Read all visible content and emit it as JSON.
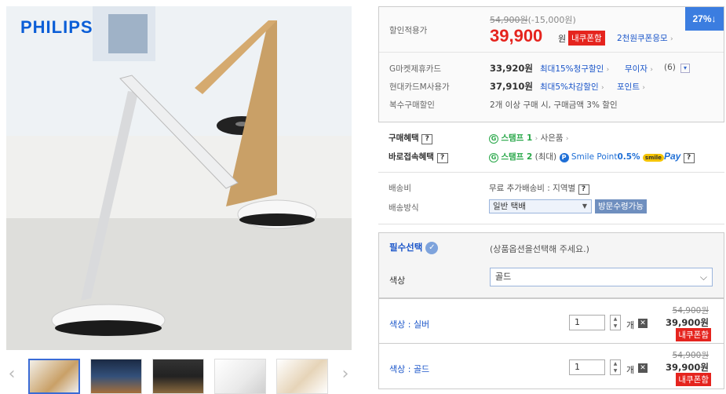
{
  "product_image": {
    "brand": "PHILIPS",
    "thumbnails": [
      {
        "name": "thumb-gold-lamp"
      },
      {
        "name": "thumb-room"
      },
      {
        "name": "thumb-desk"
      },
      {
        "name": "thumb-white-lamp"
      },
      {
        "name": "thumb-gold-lamp-2"
      }
    ]
  },
  "price": {
    "label": "할인적용가",
    "original": "54,900원",
    "discount_amount": "(-15,000원)",
    "sale": "39,900",
    "sale_unit": "원",
    "coupon_badge": "내쿠폰함",
    "coupon_link": "2천원쿠폰응모",
    "discount_badge": "27%↓"
  },
  "cards": [
    {
      "label": "G마켓제휴카드",
      "price": "33,920원",
      "benefit": "최대15%청구할인",
      "extra": "무이자",
      "extra2": "(6)"
    },
    {
      "label": "현대카드M사용가",
      "price": "37,910원",
      "benefit": "최대5%차감할인",
      "extra": "포인트"
    },
    {
      "label": "복수구매할인",
      "text": "2개 이상 구매 시, 구매금액 3% 할인"
    }
  ],
  "benefits": {
    "purchase_label": "구매혜택",
    "purchase_stamp": "스탬프 1",
    "purchase_gift": "사은품",
    "direct_label": "바로접속혜택",
    "direct_stamp": "스탬프 2",
    "direct_max": "(최대)",
    "smile_text": "Smile Point",
    "smile_pct": "0.5%",
    "smile_pay_badge": "smile",
    "pay_text": "Pay",
    "help": "?"
  },
  "shipping": {
    "fee_label": "배송비",
    "fee_value": "무료 추가배송비 : 지역별",
    "method_label": "배송방식",
    "method_value": "일반 택배",
    "visit_badge": "방문수령가능"
  },
  "required": {
    "title": "필수선택",
    "hint": "(상품옵션을선택해 주세요.)",
    "color_label": "색상",
    "color_value": "골드"
  },
  "options": [
    {
      "name": "색상 : 실버",
      "qty": "1",
      "unit": "개",
      "orig": "54,900원",
      "price": "39,900원",
      "coupon": "내쿠폰함"
    },
    {
      "name": "색상 : 골드",
      "qty": "1",
      "unit": "개",
      "orig": "54,900원",
      "price": "39,900원",
      "coupon": "내쿠폰함"
    }
  ],
  "colors": {
    "accent_red": "#e5241e",
    "link_blue": "#1a55c9",
    "badge_blue": "#3b7de0"
  }
}
